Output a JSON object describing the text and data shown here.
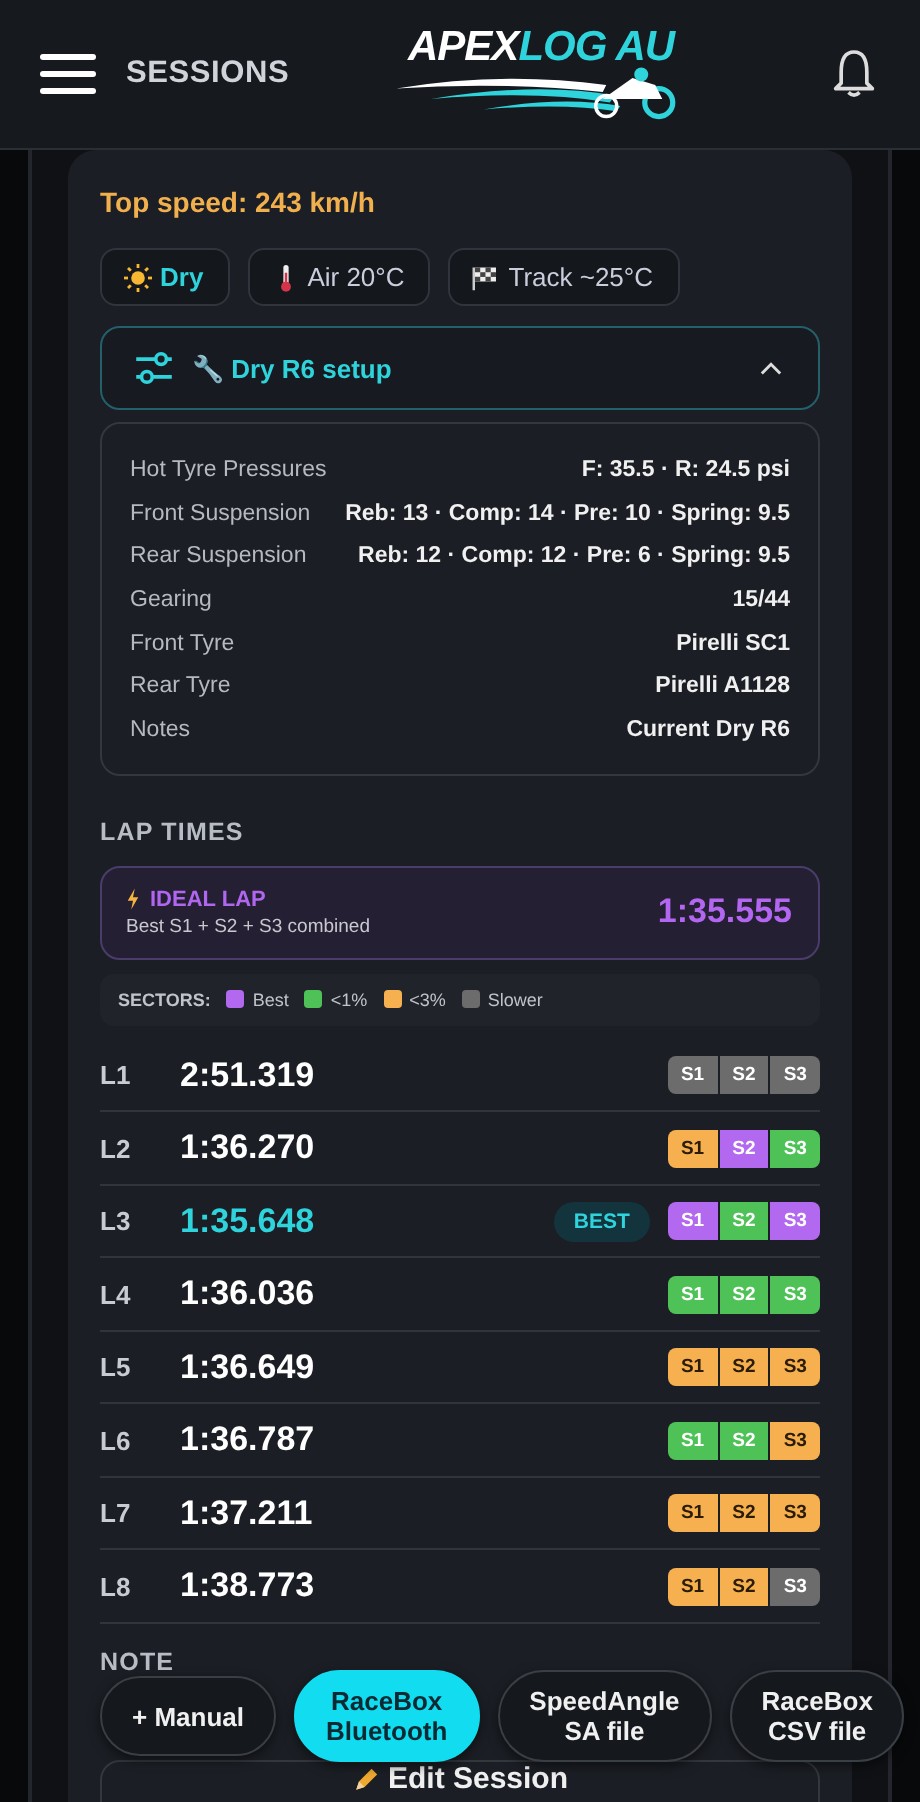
{
  "header": {
    "title": "SESSIONS",
    "logo": {
      "word_1": "APEX",
      "word_2": "LOG AU"
    }
  },
  "session": {
    "top_speed": "Top speed: 243 km/h",
    "conditions": [
      {
        "kind": "weather",
        "label": "Dry"
      },
      {
        "kind": "air",
        "label": "Air 20°C"
      },
      {
        "kind": "track",
        "label": "Track ~25°C"
      }
    ],
    "setup": {
      "title": "🔧 Dry R6 setup",
      "expanded": true,
      "rows": [
        {
          "label": "Hot Tyre Pressures",
          "value": "F: 35.5 · R: 24.5 psi"
        },
        {
          "label": "Front Suspension",
          "value": "Reb: 13 · Comp: 14 · Pre: 10 · Spring: 9.5"
        },
        {
          "label": "Rear Suspension",
          "value": "Reb: 12 · Comp: 12 · Pre: 6 · Spring: 9.5"
        },
        {
          "label": "Gearing",
          "value": "15/44"
        },
        {
          "label": "Front Tyre",
          "value": "Pirelli SC1"
        },
        {
          "label": "Rear Tyre",
          "value": "Pirelli A1128"
        },
        {
          "label": "Notes",
          "value": "Current Dry R6"
        }
      ]
    },
    "lap_times": {
      "heading": "LAP TIMES",
      "ideal": {
        "title": "IDEAL LAP",
        "subtitle": "Best S1 + S2 + S3 combined",
        "time": "1:35.555"
      },
      "legend": {
        "label": "SECTORS:",
        "items": [
          {
            "label": "Best",
            "color": "#b368f0"
          },
          {
            "label": "<1%",
            "color": "#4fc257"
          },
          {
            "label": "<3%",
            "color": "#f7b04f"
          },
          {
            "label": "Slower",
            "color": "#6c6c6c"
          }
        ]
      },
      "laps": [
        {
          "lap": "L1",
          "time": "2:51.319",
          "best": false,
          "sectors": [
            {
              "label": "S1",
              "color": "#6c6c6c"
            },
            {
              "label": "S2",
              "color": "#6c6c6c"
            },
            {
              "label": "S3",
              "color": "#6c6c6c"
            }
          ]
        },
        {
          "lap": "L2",
          "time": "1:36.270",
          "best": false,
          "sectors": [
            {
              "label": "S1",
              "color": "#f7b04f"
            },
            {
              "label": "S2",
              "color": "#b368f0"
            },
            {
              "label": "S3",
              "color": "#4fc257"
            }
          ]
        },
        {
          "lap": "L3",
          "time": "1:35.648",
          "best": true,
          "badge": "BEST",
          "sectors": [
            {
              "label": "S1",
              "color": "#b368f0"
            },
            {
              "label": "S2",
              "color": "#4fc257"
            },
            {
              "label": "S3",
              "color": "#b368f0"
            }
          ]
        },
        {
          "lap": "L4",
          "time": "1:36.036",
          "best": false,
          "sectors": [
            {
              "label": "S1",
              "color": "#4fc257"
            },
            {
              "label": "S2",
              "color": "#4fc257"
            },
            {
              "label": "S3",
              "color": "#4fc257"
            }
          ]
        },
        {
          "lap": "L5",
          "time": "1:36.649",
          "best": false,
          "sectors": [
            {
              "label": "S1",
              "color": "#f7b04f"
            },
            {
              "label": "S2",
              "color": "#f7b04f"
            },
            {
              "label": "S3",
              "color": "#f7b04f"
            }
          ]
        },
        {
          "lap": "L6",
          "time": "1:36.787",
          "best": false,
          "sectors": [
            {
              "label": "S1",
              "color": "#4fc257"
            },
            {
              "label": "S2",
              "color": "#4fc257"
            },
            {
              "label": "S3",
              "color": "#f7b04f"
            }
          ]
        },
        {
          "lap": "L7",
          "time": "1:37.211",
          "best": false,
          "sectors": [
            {
              "label": "S1",
              "color": "#f7b04f"
            },
            {
              "label": "S2",
              "color": "#f7b04f"
            },
            {
              "label": "S3",
              "color": "#f7b04f"
            }
          ]
        },
        {
          "lap": "L8",
          "time": "1:38.773",
          "best": false,
          "sectors": [
            {
              "label": "S1",
              "color": "#f7b04f"
            },
            {
              "label": "S2",
              "color": "#f7b04f"
            },
            {
              "label": "S3",
              "color": "#6c6c6c"
            }
          ]
        }
      ]
    },
    "note_heading": "NOTE",
    "edit_button": "Edit Session"
  },
  "import_buttons": [
    {
      "label": "+ Manual",
      "selected": false
    },
    {
      "label": "RaceBox\nBluetooth",
      "selected": true
    },
    {
      "label": "SpeedAngle\nSA file",
      "selected": false
    },
    {
      "label": "RaceBox\nCSV file",
      "selected": false
    }
  ]
}
